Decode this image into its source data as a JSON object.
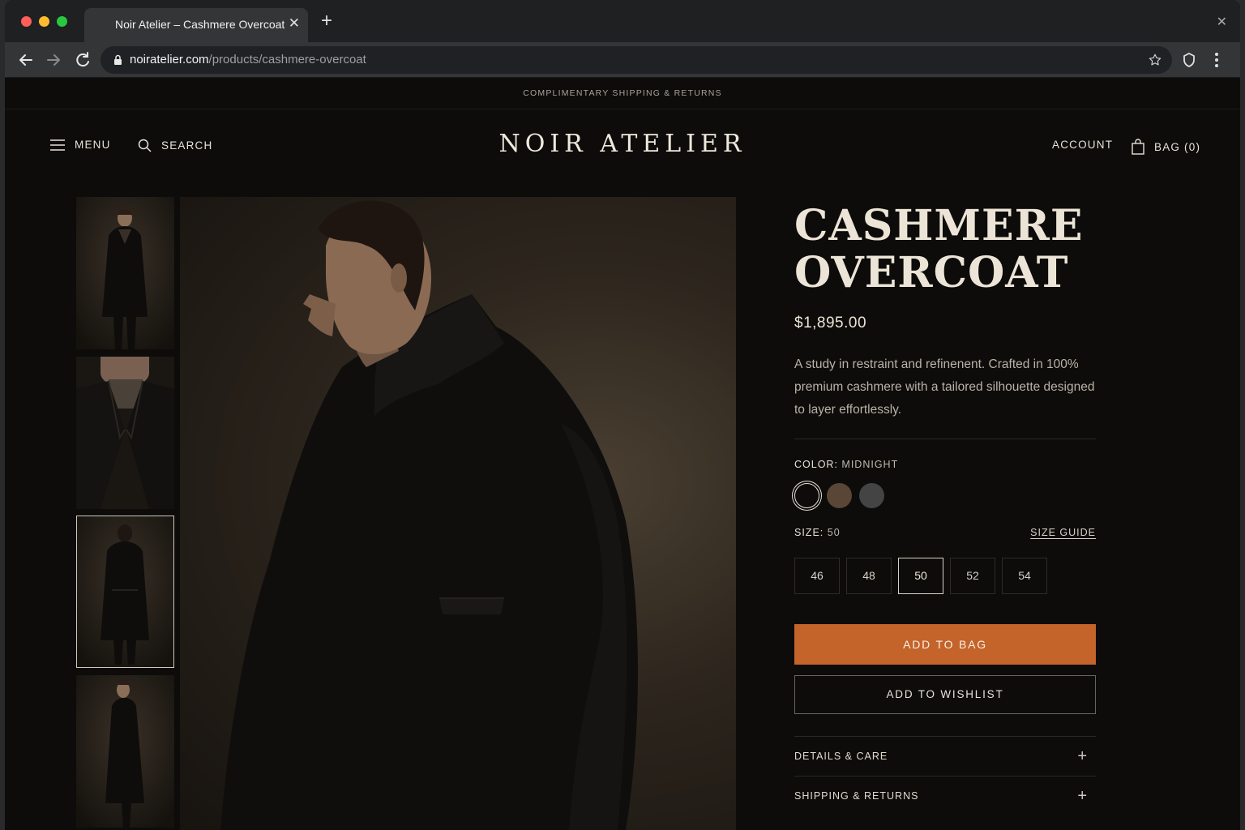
{
  "browser": {
    "tab_title": "Noir Atelier – Cashmere Overcoat",
    "url_host": "noiratelier.com",
    "url_path": "/products/cashmere-overcoat"
  },
  "site": {
    "announcement": "COMPLIMENTARY SHIPPING & RETURNS",
    "logo": "NOIR ATELIER",
    "nav": {
      "menu": "MENU",
      "search": "SEARCH",
      "account": "ACCOUNT",
      "bag": "BAG (0)"
    }
  },
  "gallery": {
    "thumbnail_count": 4,
    "active_thumbnail_index": 2
  },
  "product": {
    "title_line1": "CASHMERE",
    "title_line2": "OVERCOAT",
    "price": "$1,895.00",
    "description": "A study in restraint and refinenent. Crafted in 100% premium cashmere with a tailored silhouette designed to layer effortlessly.",
    "color_label": "COLOR:",
    "color_value": "MIDNIGHT",
    "colors": [
      {
        "name": "midnight",
        "hex": "#0d0c0b",
        "selected": true
      },
      {
        "name": "brown",
        "hex": "#5a4636",
        "selected": false
      },
      {
        "name": "charcoal",
        "hex": "#444444",
        "selected": false
      }
    ],
    "size_label": "SIZE:",
    "size_value": "50",
    "size_guide": "SIZE GUIDE",
    "sizes": [
      "46",
      "48",
      "50",
      "52",
      "54"
    ],
    "selected_size": "50",
    "add_to_bag": "ADD TO BAG",
    "add_to_wishlist": "ADD TO WISHLIST",
    "accordions": [
      {
        "label": "DETAILS & CARE"
      },
      {
        "label": "SHIPPING & RETURNS"
      }
    ]
  },
  "colors": {
    "accent": "#c4632a",
    "background": "#0d0c0b"
  }
}
